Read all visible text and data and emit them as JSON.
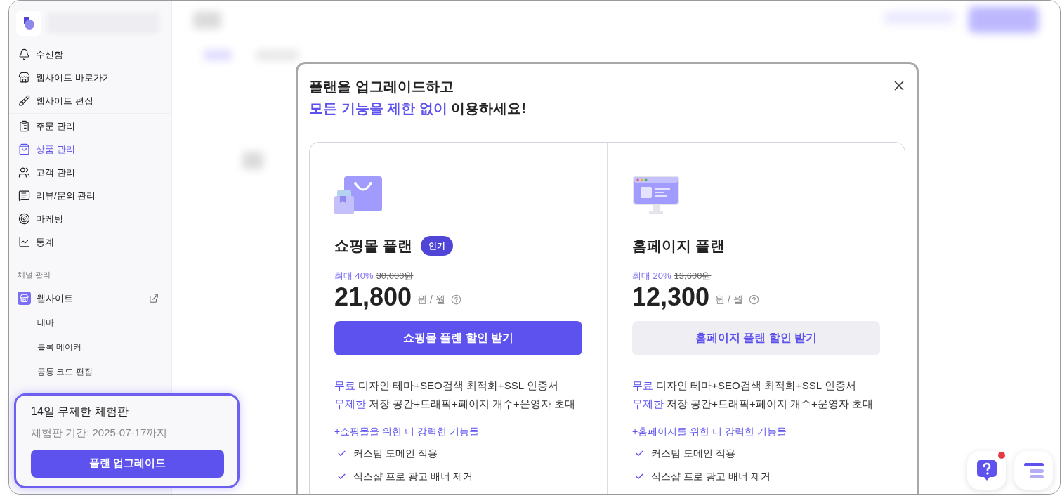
{
  "sidebar": {
    "items": [
      {
        "label": "수신함",
        "selected": false
      },
      {
        "label": "웹사이트 바로가기",
        "selected": false
      },
      {
        "label": "웹사이트 편집",
        "selected": false
      },
      {
        "label": "주문 관리",
        "selected": false
      },
      {
        "label": "상품 관리",
        "selected": true
      },
      {
        "label": "고객 관리",
        "selected": false
      },
      {
        "label": "리뷰/문의 관리",
        "selected": false
      },
      {
        "label": "마케팅",
        "selected": false
      },
      {
        "label": "통계",
        "selected": false
      }
    ],
    "section_title": "채널 관리",
    "channel": {
      "label": "웹사이트"
    },
    "sub_items": [
      "테마",
      "블록 메이커",
      "공통 코드 편집"
    ]
  },
  "trial_card": {
    "title": "14일 무제한 체험판",
    "period": "체험판 기간: 2025-07-17까지",
    "button": "플랜 업그레이드"
  },
  "modal": {
    "title_line1": "플랜을 업그레이드하고",
    "title_highlight": "모든 기능을 제한 없이",
    "title_rest": "이용하세요!",
    "plans": [
      {
        "kind": "shop",
        "name": "쇼핑몰 플랜",
        "badge": "인기",
        "discount": "최대 40%",
        "original_price": "30,000원",
        "price": "21,800",
        "unit": "원 / 월",
        "button": "쇼핑몰 플랜 할인 받기",
        "primary": true,
        "features": [
          {
            "highlight": "무료",
            "text": "디자인 테마+SEO검색 최적화+SSL 인증서"
          },
          {
            "highlight": "무제한",
            "text": "저장 공간+트래픽+페이지 개수+운영자 초대"
          }
        ],
        "extra_title": "+쇼핑몰을 위한 더 강력한 기능들",
        "checks": [
          "커스텀 도메인 적용",
          "식스샵 프로 광고 배너 제거"
        ]
      },
      {
        "kind": "homepage",
        "name": "홈페이지 플랜",
        "discount": "최대 20%",
        "original_price": "13,600원",
        "price": "12,300",
        "unit": "원 / 월",
        "button": "홈페이지 플랜 할인 받기",
        "primary": false,
        "features": [
          {
            "highlight": "무료",
            "text": "디자인 테마+SEO검색 최적화+SSL 인증서"
          },
          {
            "highlight": "무제한",
            "text": "저장 공간+트래픽+페이지 개수+운영자 초대"
          }
        ],
        "extra_title": "+홈페이지를 위한 더 강력한 기능들",
        "checks": [
          "커스텀 도메인 적용",
          "식스샵 프로 광고 배너 제거"
        ]
      }
    ]
  },
  "floating_buttons": {
    "help_notification": true
  }
}
